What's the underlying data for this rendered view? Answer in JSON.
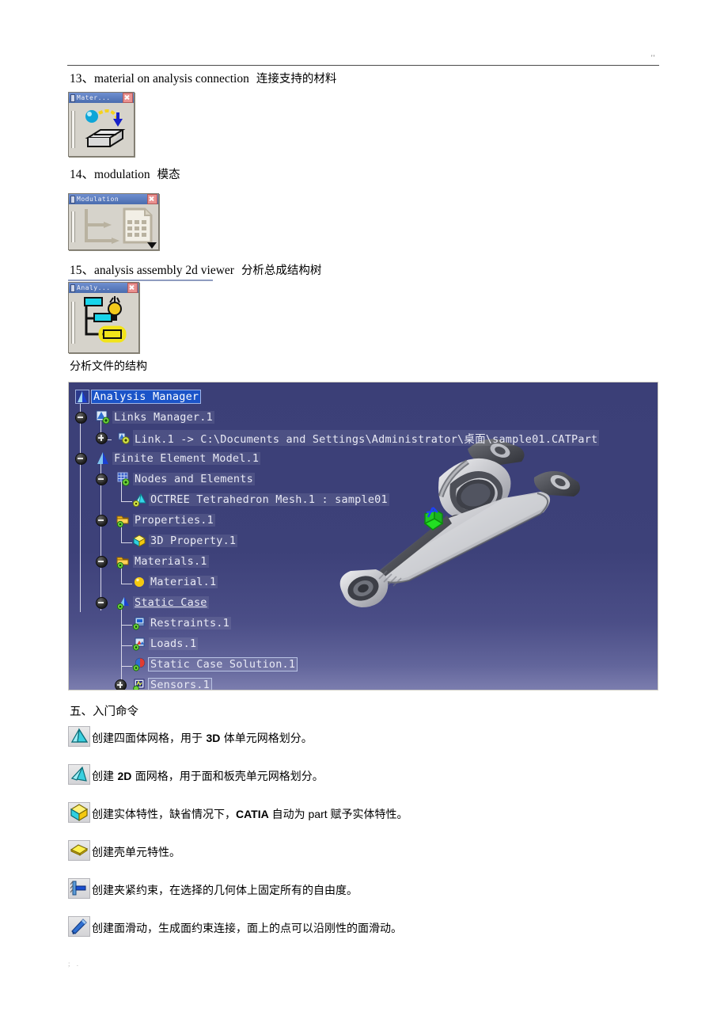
{
  "header": {
    "marks": "''"
  },
  "footer": {
    "marks": "; ."
  },
  "items": [
    {
      "num": "13、",
      "en": "material on analysis connection",
      "cn": "连接支持的材料",
      "palette": {
        "title": "Mater...",
        "icon": "material-on-analysis-connection-icon",
        "close": "close-icon"
      }
    },
    {
      "num": "14、",
      "en": "modulation",
      "cn": "模态",
      "palette": {
        "title": "Modulation",
        "icon": "modulation-icon",
        "close": "close-icon",
        "dropdown": "more-commands-arrow"
      }
    },
    {
      "num": "15、",
      "en": "analysis assembly 2d viewer",
      "cn": "分析总成结构树",
      "palette": {
        "title": "Analy...",
        "icon": "analysis-assembly-2d-viewer-icon",
        "close": "close-icon"
      }
    }
  ],
  "tree_caption": "分析文件的结构",
  "tree": {
    "rows": [
      {
        "label": "Analysis Manager",
        "icon": "analysis-manager-icon",
        "indent": 0,
        "state": "selected"
      },
      {
        "label": "Links Manager.1",
        "icon": "links-manager-icon",
        "indent": 1,
        "expander": "minus"
      },
      {
        "label": "Link.1 -> C:\\Documents and Settings\\Administrator\\桌面\\sample01.CATPart",
        "icon": "link-icon",
        "indent": 2,
        "expander": "plus"
      },
      {
        "label": "Finite Element Model.1",
        "icon": "finite-element-model-icon",
        "indent": 1,
        "expander": "minus"
      },
      {
        "label": "Nodes and Elements",
        "icon": "nodes-and-elements-icon",
        "indent": 2,
        "expander": "minus"
      },
      {
        "label": "OCTREE Tetrahedron Mesh.1 : sample01",
        "icon": "tetrahedron-mesh-icon",
        "indent": 3
      },
      {
        "label": "Properties.1",
        "icon": "properties-folder-icon",
        "indent": 2,
        "expander": "minus"
      },
      {
        "label": "3D Property.1",
        "icon": "3d-property-icon",
        "indent": 3
      },
      {
        "label": "Materials.1",
        "icon": "materials-folder-icon",
        "indent": 2,
        "expander": "minus"
      },
      {
        "label": "Material.1",
        "icon": "material-sphere-icon",
        "indent": 3
      },
      {
        "label": "Static Case",
        "icon": "static-case-icon",
        "indent": 2,
        "expander": "minus",
        "state": "underlined"
      },
      {
        "label": "Restraints.1",
        "icon": "restraints-icon",
        "indent": 3
      },
      {
        "label": "Loads.1",
        "icon": "loads-icon",
        "indent": 3
      },
      {
        "label": "Static Case Solution.1",
        "icon": "static-case-solution-icon",
        "indent": 3,
        "state": "boxed"
      },
      {
        "label": "Sensors.1",
        "icon": "sensors-icon",
        "indent": 3,
        "expander": "plus",
        "state": "boxed"
      }
    ],
    "model_label": "sample01",
    "colors": {
      "bg_top": "#3b3f77",
      "bg_bottom": "#7b7dae",
      "selection": "#1b54c8",
      "text": "#e9eaf5"
    }
  },
  "section": {
    "heading": "五、入门命令"
  },
  "commands": [
    {
      "icon": "tetrahedron-mesh-icon",
      "text_pre": "创建四面体网格，用于 ",
      "bold": "3D",
      "text_post": " 体单元网格划分。"
    },
    {
      "icon": "surface-mesh-icon",
      "text_pre": "创建 ",
      "bold": "2D",
      "text_post": " 面网格，用于面和板壳单元网格划分。"
    },
    {
      "icon": "3d-property-icon",
      "text_pre": "创建实体特性，缺省情况下，",
      "bold": "CATIA",
      "text_post": " 自动为 part 赋予实体特性。"
    },
    {
      "icon": "shell-property-icon",
      "text_pre": "创建壳单元特性。",
      "bold": "",
      "text_post": ""
    },
    {
      "icon": "clamp-restraint-icon",
      "text_pre": "创建夹紧约束，在选择的几何体上固定所有的自由度。",
      "bold": "",
      "text_post": ""
    },
    {
      "icon": "surface-slider-icon",
      "text_pre": "创建面滑动，生成面约束连接，面上的点可以沿刚性的面滑动。",
      "bold": "",
      "text_post": ""
    }
  ]
}
